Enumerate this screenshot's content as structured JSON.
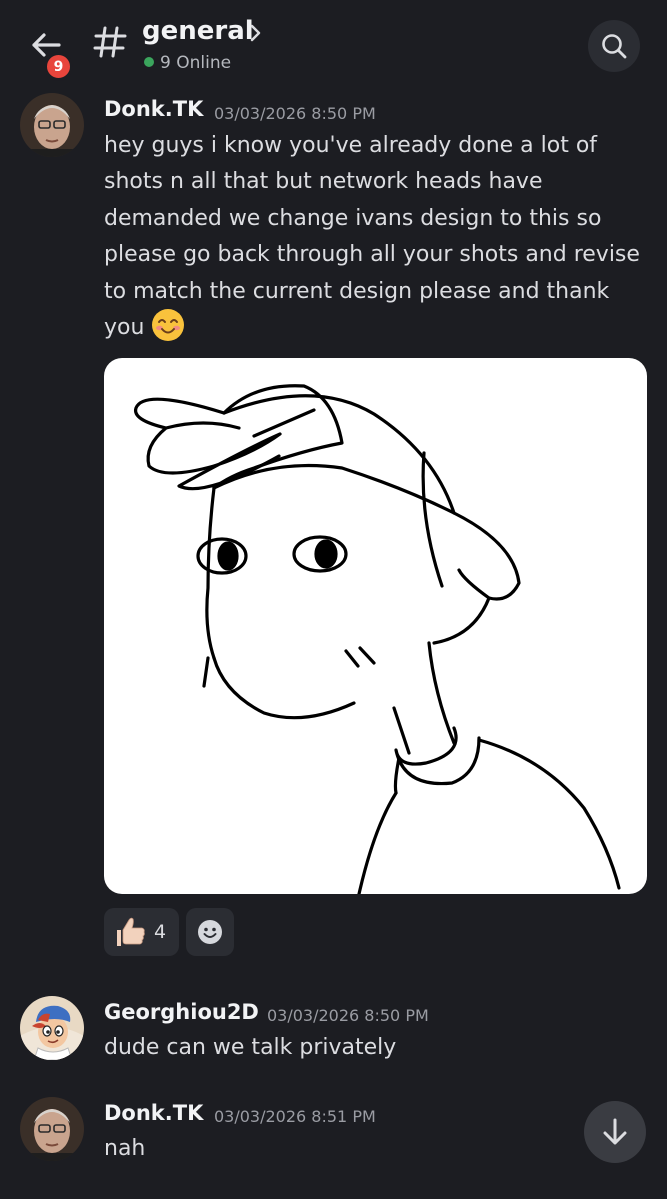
{
  "header": {
    "unread_count": "9",
    "channel_prefix_icon": "hash-icon",
    "channel_name": "general",
    "online_status": "9 Online",
    "colors": {
      "online": "#3ba55d",
      "badge": "#e8453c"
    }
  },
  "messages": [
    {
      "username": "Donk.TK",
      "timestamp": "03/03/2026 8:50 PM",
      "lines": [
        "hey guys i know you've already done a lot of",
        "shots n all that but network heads have",
        "demanded we change ivans design to this so",
        "please go back through all your shots and revise",
        "to match the current design please and thank",
        "you"
      ],
      "trailing_emoji": "smiling-face-emoji",
      "attachment": "line drawing of a character wearing a backwards cap",
      "reactions": [
        {
          "icon": "thumbs-up-emoji",
          "count": "4"
        }
      ],
      "add_reaction_icon": "add-reaction-icon"
    },
    {
      "username": "Georghiou2D",
      "timestamp": "03/03/2026 8:50 PM",
      "text": "dude can we talk privately"
    },
    {
      "username": "Donk.TK",
      "timestamp": "03/03/2026 8:51 PM",
      "text": "nah"
    }
  ]
}
